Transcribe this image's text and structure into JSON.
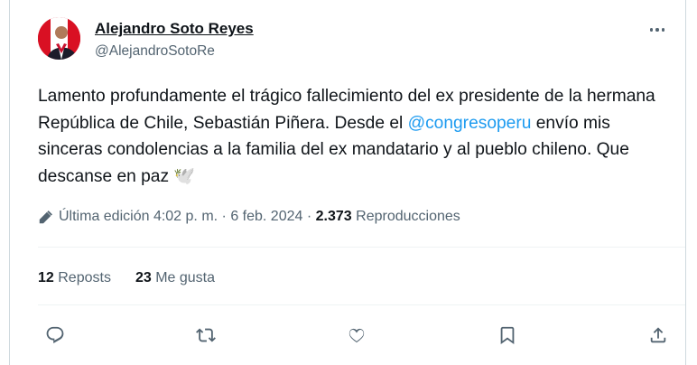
{
  "author": {
    "name": "Alejandro Soto Reyes",
    "handle": "@AlejandroSotoRe"
  },
  "post": {
    "text_before_mention": "Lamento profundamente el trágico fallecimiento del ex presidente de la hermana República de Chile, Sebastián Piñera. Desde el ",
    "mention": "@congresoperu",
    "text_after_mention": " envío mis sinceras condolencias a la familia del ex mandatario y al pueblo chileno. Que descanse en paz ",
    "emoji": "🕊️"
  },
  "meta": {
    "edited_label": "Última edición",
    "time": "4:02 p. m.",
    "separator": "·",
    "date": "6 feb. 2024",
    "views_count": "2.373",
    "views_label": "Reproducciones"
  },
  "stats": {
    "reposts_count": "12",
    "reposts_label": "Reposts",
    "likes_count": "23",
    "likes_label": "Me gusta"
  },
  "icons": {
    "more": "more-icon",
    "edit": "pencil-icon",
    "reply": "reply-icon",
    "repost": "repost-icon",
    "like": "heart-icon",
    "bookmark": "bookmark-icon",
    "share": "share-icon"
  },
  "colors": {
    "text": "#0f1419",
    "secondary": "#536471",
    "link": "#1d9bf0",
    "divider": "#eff3f4"
  }
}
